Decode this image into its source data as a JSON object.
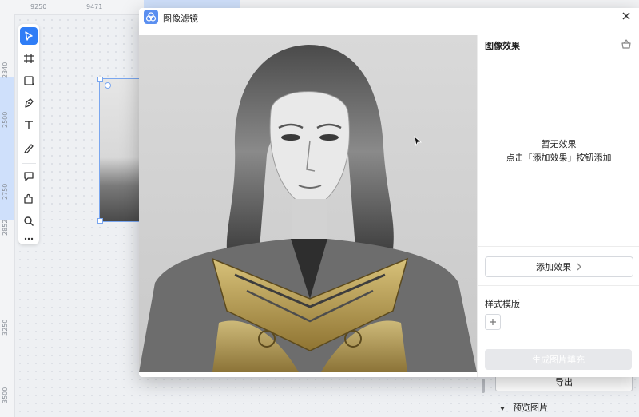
{
  "rulers": {
    "top": [
      "9250",
      "9471"
    ],
    "left": [
      "2340",
      "2500",
      "2750",
      "2852",
      "3250",
      "3500"
    ]
  },
  "toolbar": {
    "tools": [
      {
        "name": "select-tool",
        "icon": "pointer-icon",
        "active": true
      },
      {
        "name": "frame-tool",
        "icon": "frame-icon"
      },
      {
        "name": "shape-tool",
        "icon": "rectangle-icon"
      },
      {
        "name": "pen-tool",
        "icon": "pen-icon"
      },
      {
        "name": "text-tool",
        "icon": "text-icon"
      },
      {
        "name": "pencil-tool",
        "icon": "pencil-icon"
      },
      {
        "name": "comment-tool",
        "icon": "comment-icon"
      },
      {
        "name": "plugin-tool",
        "icon": "puzzle-icon"
      },
      {
        "name": "search-tool",
        "icon": "search-icon"
      },
      {
        "name": "more-tool",
        "icon": "more-icon"
      }
    ]
  },
  "dialog": {
    "title": "图像滤镜",
    "panel": {
      "title": "图像效果",
      "empty_line1": "暂无效果",
      "empty_line2": "点击「添加效果」按钮添加",
      "add_button": "添加效果",
      "template_title": "样式模版",
      "generate_button": "生成图片填充"
    }
  },
  "behind": {
    "export_button": "导出",
    "preview_label": "预览图片"
  },
  "colors": {
    "accent": "#2f7df6",
    "gold": "#b99a45"
  }
}
